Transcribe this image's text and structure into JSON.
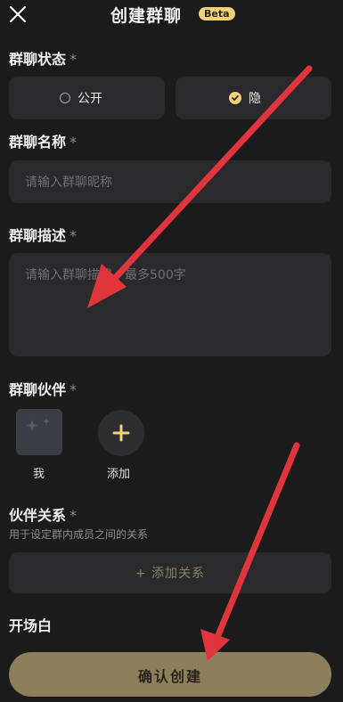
{
  "header": {
    "title": "创建群聊",
    "badge": "Beta",
    "close_icon": "close-icon"
  },
  "status": {
    "label": "群聊状态",
    "required_mark": "*",
    "options": [
      {
        "label": "公开",
        "selected": false
      },
      {
        "label": "隐",
        "selected": true
      }
    ]
  },
  "name": {
    "label": "群聊名称",
    "required_mark": "*",
    "placeholder": "请输入群聊昵称"
  },
  "description": {
    "label": "群聊描述",
    "required_mark": "*",
    "placeholder": "请输入群聊描述，最多500字"
  },
  "partners": {
    "label": "群聊伙伴",
    "required_mark": "*",
    "me_label": "我",
    "add_label": "添加"
  },
  "relations": {
    "label": "伙伴关系",
    "required_mark": "*",
    "hint": "用于设定群内成员之间的关系",
    "add_button": "+  添加关系"
  },
  "opening": {
    "label": "开场白"
  },
  "footer": {
    "confirm_button": "确认创建"
  },
  "colors": {
    "accent": "#f2d17a",
    "arrow": "#e0353c",
    "background": "#1b1b1c",
    "field": "#2a2a2c"
  }
}
